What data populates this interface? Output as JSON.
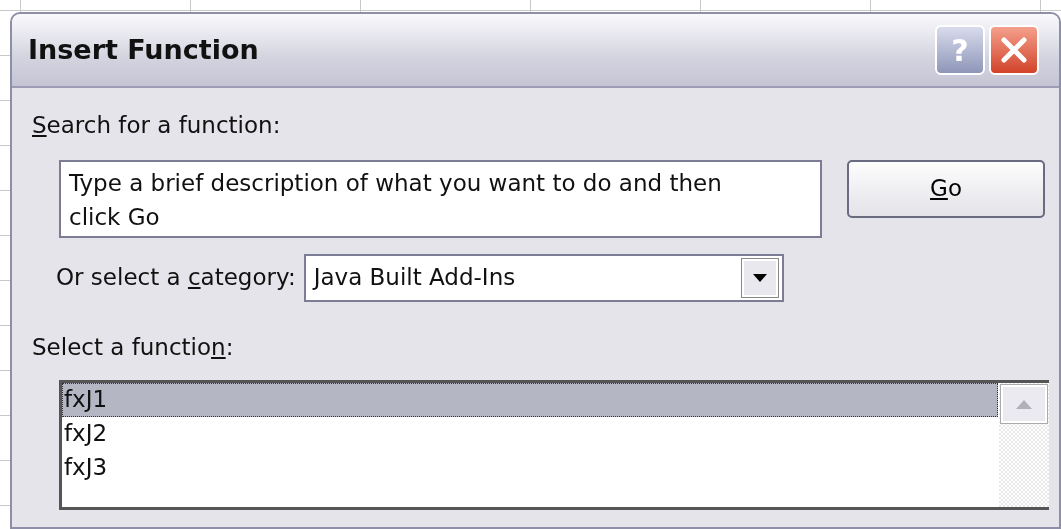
{
  "window": {
    "title": "Insert Function"
  },
  "title_buttons": [
    {
      "kind": "help",
      "label": "?"
    },
    {
      "kind": "close"
    }
  ],
  "search": {
    "label": {
      "key": "S",
      "after": "earch for a function:"
    },
    "value": "Type a brief description of what you want to do and then click Go"
  },
  "go_button": {
    "label": {
      "key": "G",
      "after": "o"
    }
  },
  "category": {
    "label": {
      "before": "Or select a ",
      "key": "c",
      "after": "ategory:"
    },
    "value": "Java Built Add-Ins"
  },
  "function_list": {
    "label": {
      "before": "Select a functio",
      "key": "n",
      "after": ":"
    },
    "items": [
      {
        "name": "fxJ1",
        "selected": true
      },
      {
        "name": "fxJ2",
        "selected": false
      },
      {
        "name": "fxJ3",
        "selected": false
      }
    ]
  }
}
